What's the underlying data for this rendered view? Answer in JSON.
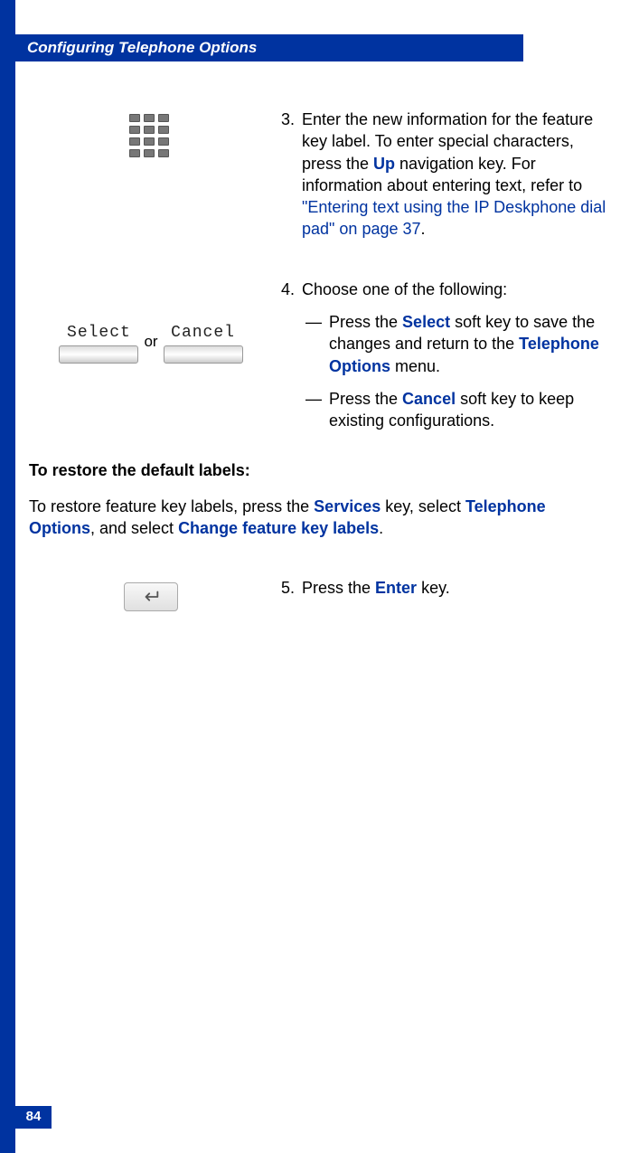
{
  "header": {
    "title": "Configuring Telephone Options"
  },
  "page_number": "84",
  "steps": {
    "step3": {
      "num": "3.",
      "text_prefix": "Enter the new information for the feature key label. To enter special characters, press the ",
      "up_key": "Up",
      "text_mid": " navigation key. For information about entering text, refer to ",
      "link": "\"Entering text using the IP Deskphone dial pad\" on page 37",
      "text_suffix": "."
    },
    "step4": {
      "num": "4.",
      "intro": "Choose one of the following:",
      "softkeys": {
        "select": "Select",
        "cancel": "Cancel",
        "or": "or"
      },
      "bullet1_prefix": "Press the ",
      "bullet1_key": "Select",
      "bullet1_mid": " soft key to save the changes and return to the ",
      "bullet1_menu": "Telephone Options",
      "bullet1_suffix": " menu.",
      "bullet2_prefix": "Press the ",
      "bullet2_key": "Cancel",
      "bullet2_suffix": " soft key to keep existing configurations."
    },
    "restore": {
      "heading": "To restore the default labels:",
      "para_prefix": "To restore feature key labels, press the ",
      "services_key": "Services",
      "para_mid1": " key, select ",
      "telephone_options": "Telephone Options",
      "para_mid2": ", and select ",
      "change_feature": "Change feature key labels",
      "para_suffix": "."
    },
    "step5": {
      "num": "5.",
      "text_prefix": "Press the ",
      "enter_key": "Enter",
      "text_suffix": " key."
    }
  }
}
